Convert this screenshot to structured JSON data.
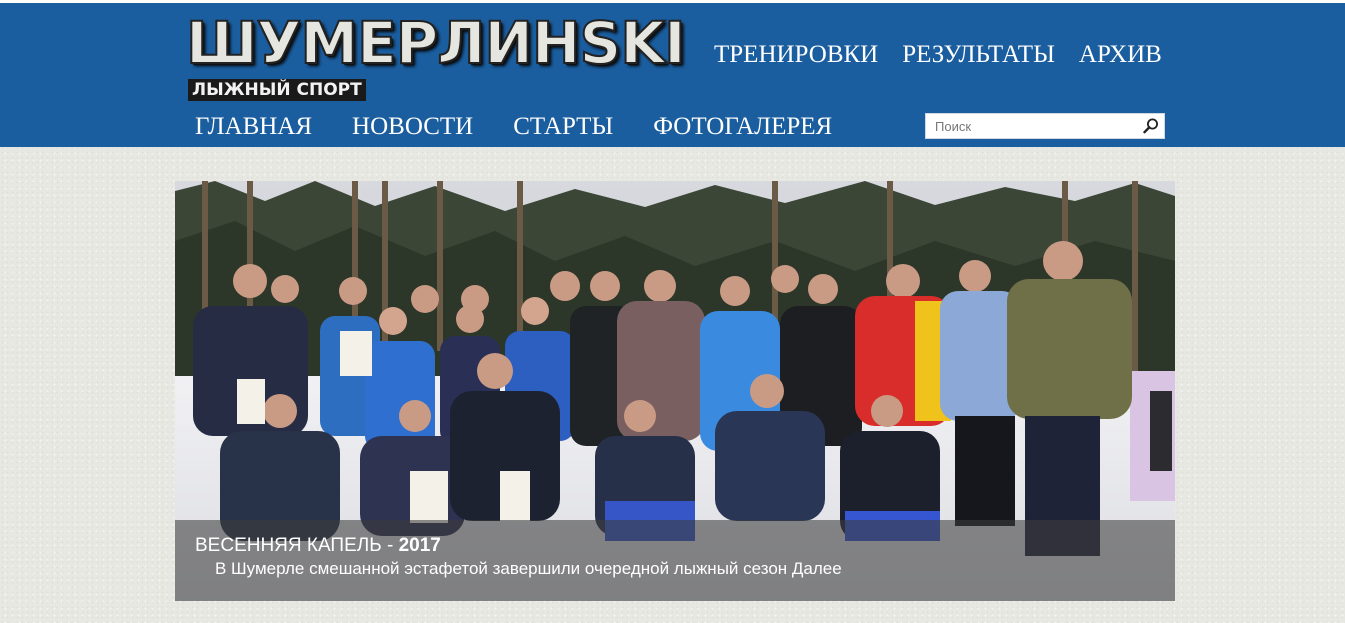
{
  "site": {
    "logo_title": "ШУМЕРЛИНSKI",
    "logo_subtitle": "ЛЫЖНЫЙ СПОРТ"
  },
  "nav_top": [
    "ТРЕНИРОВКИ",
    "РЕЗУЛЬТАТЫ",
    "АРХИВ"
  ],
  "nav_main": [
    "ГЛАВНАЯ",
    "НОВОСТИ",
    "СТАРТЫ",
    "ФОТОГАЛЕРЕЯ"
  ],
  "search": {
    "placeholder": "Поиск",
    "icon": "search-icon"
  },
  "slide": {
    "title": "ВЕСЕННЯЯ КАПЕЛЬ - ",
    "title_year": "2017",
    "text": "В Шумерле смешанной эстафетой завершили очередной лыжный сезон Далее"
  },
  "colors": {
    "header_bg": "#1b5e9f",
    "page_bg": "#e8e8e3",
    "nav_text": "#ffffff"
  }
}
